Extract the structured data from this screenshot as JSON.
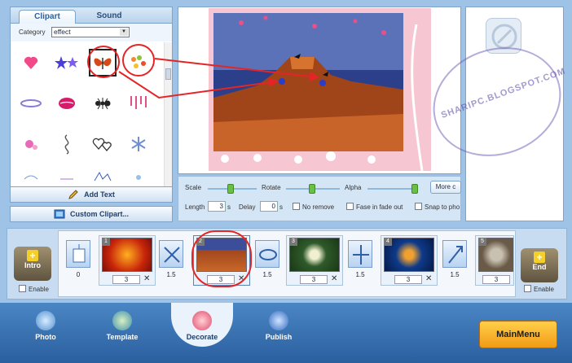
{
  "clipart_panel": {
    "tabs": [
      "Clipart",
      "Sound"
    ],
    "category_label": "Category",
    "category_value": "effect",
    "items": [
      "heart-icon",
      "stars-icon",
      "butterfly-icon",
      "leaves-icon",
      "ring-icon",
      "lips-icon",
      "ant-icon",
      "drips-icon",
      "pink-splash-icon",
      "swirl-icon",
      "hearts-outline-icon",
      "snowflake-icon",
      "bottom-decor-1",
      "bottom-decor-2",
      "bottom-decor-3",
      "bottom-decor-4"
    ]
  },
  "buttons": {
    "add_text": "Add Text",
    "custom_clipart": "Custom Clipart...",
    "more": "More c"
  },
  "controls": {
    "scale_label": "Scale",
    "rotate_label": "Rotate",
    "alpha_label": "Alpha",
    "length_label": "Length",
    "length_value": "3",
    "length_unit": "s",
    "delay_label": "Delay",
    "delay_value": "0",
    "delay_unit": "s",
    "no_remove_label": "No remove",
    "fade_label": "Fase in fade out",
    "snap_label": "Snap to pho"
  },
  "watermark": "SHARIPC.BLOGSPOT.COM",
  "timeline": {
    "intro_label": "Intro",
    "end_label": "End",
    "enable_label": "Enable",
    "end_enable_label": "Enable",
    "slides": [
      {
        "index": "1",
        "duration": "3"
      },
      {
        "index": "2",
        "duration": "3"
      },
      {
        "index": "3",
        "duration": "3"
      },
      {
        "index": "4",
        "duration": "3"
      },
      {
        "index": "5",
        "duration": "3"
      }
    ],
    "transitions": [
      "0",
      "1.5",
      "1.5",
      "1.5",
      "1.5"
    ]
  },
  "nav": {
    "photo": "Photo",
    "template": "Template",
    "decorate": "Decorate",
    "publish": "Publish",
    "main_menu": "MainMenu"
  },
  "colors": {
    "accent_red": "#e52525",
    "main_menu": "#f6b82a"
  }
}
